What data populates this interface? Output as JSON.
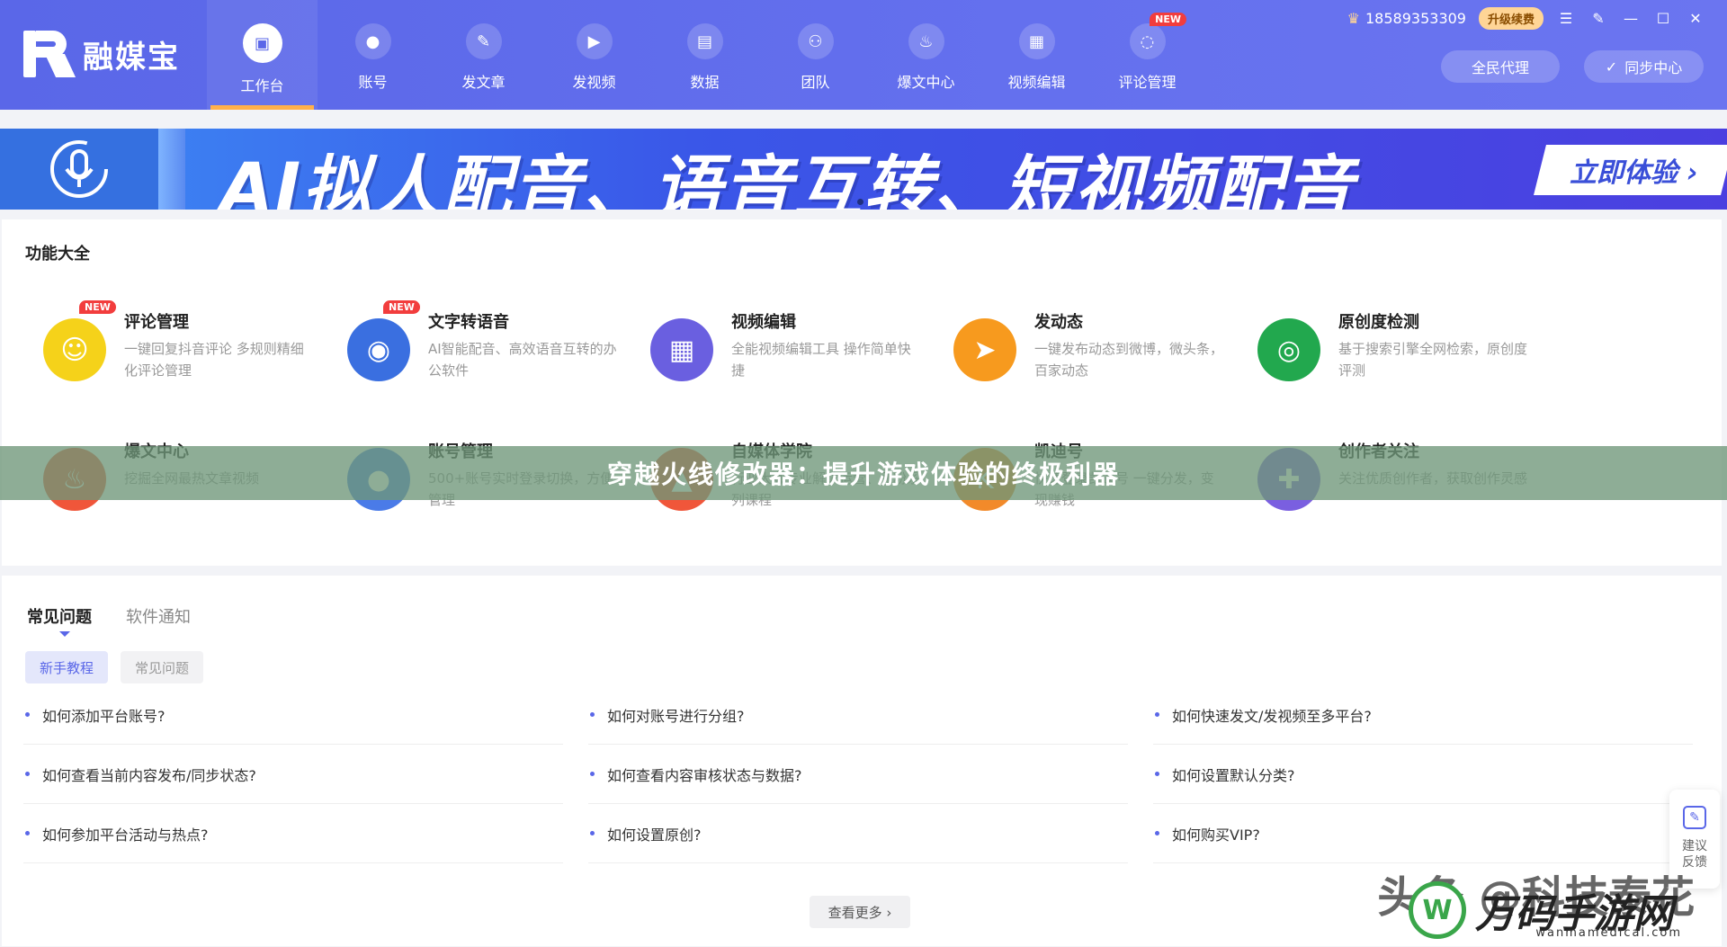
{
  "app": {
    "name": "融媒宝"
  },
  "nav": {
    "tabs": [
      {
        "label": "工作台",
        "icon": "monitor-icon",
        "glyph": "▣",
        "active": true
      },
      {
        "label": "账号",
        "icon": "user-icon",
        "glyph": "●"
      },
      {
        "label": "发文章",
        "icon": "feather-icon",
        "glyph": "✎"
      },
      {
        "label": "发视频",
        "icon": "play-icon",
        "glyph": "▶"
      },
      {
        "label": "数据",
        "icon": "chart-icon",
        "glyph": "▤"
      },
      {
        "label": "团队",
        "icon": "team-icon",
        "glyph": "⚇"
      },
      {
        "label": "爆文中心",
        "icon": "flame-icon",
        "glyph": "♨"
      },
      {
        "label": "视频编辑",
        "icon": "briefcase-icon",
        "glyph": "▦"
      },
      {
        "label": "评论管理",
        "icon": "comment-icon",
        "glyph": "◌",
        "badge": "NEW"
      }
    ]
  },
  "topright": {
    "phone": "18589353309",
    "upgrade": "升级续费",
    "agent_button": "全民代理",
    "sync_button": "同步中心"
  },
  "banner": {
    "title": "AI拟人配音、语音互转、短视频配音",
    "cta": "立即体验 ›"
  },
  "features": {
    "title": "功能大全",
    "items": [
      {
        "name": "评论管理",
        "desc": "一键回复抖音评论 多规则精细化评论管理",
        "icon": "chat-icon",
        "glyph": "☺",
        "color": "#f5d21a",
        "badge": "NEW"
      },
      {
        "name": "文字转语音",
        "desc": "AI智能配音、高效语音互转的办公软件",
        "icon": "voice-icon",
        "glyph": "◉",
        "color": "#3a6fe0",
        "badge": "NEW"
      },
      {
        "name": "视频编辑",
        "desc": "全能视频编辑工具 操作简单快捷",
        "icon": "toolbox-icon",
        "glyph": "▦",
        "color": "#6a5fe0"
      },
      {
        "name": "发动态",
        "desc": "一键发布动态到微博，微头条，百家动态",
        "icon": "paper-plane-icon",
        "glyph": "➤",
        "color": "#f79a1e"
      },
      {
        "name": "原创度检测",
        "desc": "基于搜索引擎全网检索，原创度评测",
        "icon": "target-icon",
        "glyph": "◎",
        "color": "#22a84e"
      },
      {
        "name": "爆文中心",
        "desc": "挖掘全网最热文章视频",
        "icon": "flame-icon",
        "glyph": "♨",
        "color": "#f0563a"
      },
      {
        "name": "账号管理",
        "desc": "500+账号实时登录切换，方便管理",
        "icon": "account-icon",
        "glyph": "●",
        "color": "#4a7be8"
      },
      {
        "name": "自媒体学院",
        "desc": "行业大咖专业解读运营、涨粉系列课程",
        "icon": "school-icon",
        "glyph": "▲",
        "color": "#f0563a"
      },
      {
        "name": "凯迪号",
        "desc": "快速登录凯迪号 一键分发，变现赚钱",
        "icon": "kd-icon",
        "glyph": "K",
        "color": "#f28a2a"
      },
      {
        "name": "创作者关注",
        "desc": "关注优质创作者，获取创作灵感",
        "icon": "follow-icon",
        "glyph": "✚",
        "color": "#7a5fe0"
      }
    ]
  },
  "overlay": {
    "text": "穿越火线修改器：提升游戏体验的终极利器"
  },
  "faq": {
    "tabs": [
      "常见问题",
      "软件通知"
    ],
    "chips": [
      "新手教程",
      "常见问题"
    ],
    "questions": [
      "如何添加平台账号?",
      "如何对账号进行分组?",
      "如何快速发文/发视频至多平台?",
      "如何查看当前内容发布/同步状态?",
      "如何查看内容审核状态与数据?",
      "如何设置默认分类?",
      "如何参加平台活动与热点?",
      "如何设置原创?",
      "如何购买VIP?"
    ],
    "more": "查看更多 ›"
  },
  "feedback": {
    "label": "建议反馈"
  },
  "watermark": {
    "source": "头条 @科技泰花",
    "site_name": "万码手游网",
    "site_glyph": "W",
    "site_url": "wanmamedical.com"
  }
}
